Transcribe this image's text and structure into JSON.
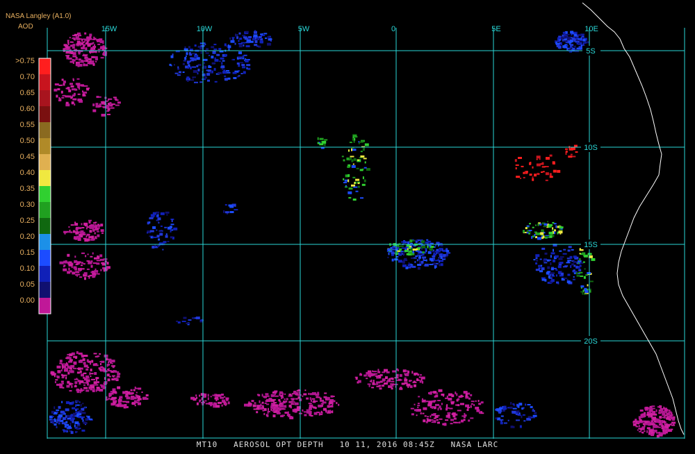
{
  "header": {
    "source": "NASA Langley (A1.0)",
    "variable": "AOD"
  },
  "legend": {
    "labels": [
      ">0.75",
      "0.70",
      "0.65",
      "0.60",
      "0.55",
      "0.50",
      "0.45",
      "0.40",
      "0.35",
      "0.30",
      "0.25",
      "0.20",
      "0.15",
      "0.10",
      "0.05",
      "0.00"
    ],
    "colors": [
      "#ff1e1e",
      "#c8141e",
      "#a8141e",
      "#7a1010",
      "#8a6a20",
      "#b08a28",
      "#e0b050",
      "#f0e840",
      "#30d030",
      "#20a020",
      "#106810",
      "#1c90e8",
      "#1c4cff",
      "#1020b8",
      "#101070",
      "#c01898"
    ]
  },
  "axes": {
    "lon_labels": [
      "15W",
      "10W",
      "5W",
      "0",
      "5E",
      "10E"
    ],
    "lat_labels": [
      "5S",
      "10S",
      "15S",
      "20S"
    ]
  },
  "footer": {
    "product": "MT10",
    "title": "AEROSOL OPT DEPTH",
    "date": "10 11, 2016",
    "time": "08:45Z",
    "agency": "NASA LARC"
  },
  "colors": {
    "grid": "#2ad8d8",
    "coast": "#ffffff",
    "text": "#e8b060"
  }
}
